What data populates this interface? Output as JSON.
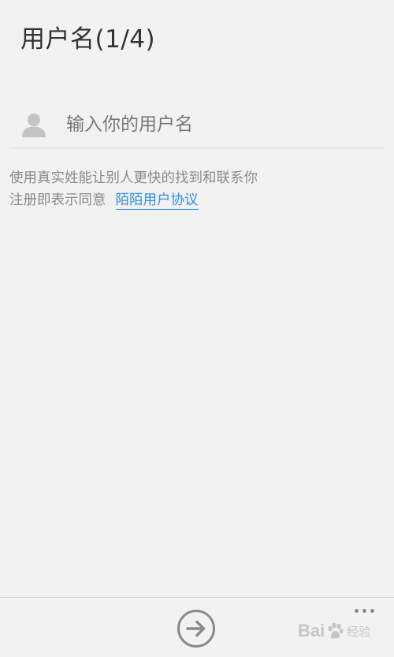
{
  "header": {
    "title": "用户名(1/4)"
  },
  "form": {
    "username_placeholder": "输入你的用户名",
    "username_value": ""
  },
  "hint": {
    "line1": "使用真实姓能让别人更快的找到和联系你",
    "line2_prefix": "注册即表示同意",
    "agreement_link": "陌陌用户协议"
  },
  "icons": {
    "user": "user-silhouette-icon",
    "next": "arrow-right-circle-icon",
    "more": "more-dots-icon"
  },
  "colors": {
    "background": "#f2f2f2",
    "title": "#333333",
    "hint": "#8a8a8a",
    "link": "#2f8fe0",
    "icon": "#c4c4c4",
    "divider": "#dcdcdc"
  },
  "watermark": {
    "text_left": "Bai",
    "text_right": "经验",
    "url": "jingyan.baidu.com"
  }
}
